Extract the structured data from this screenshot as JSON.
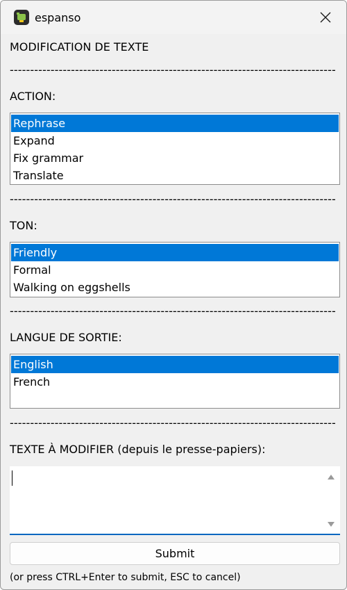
{
  "window": {
    "title": "espanso",
    "app_icon": "espanso-logo-icon",
    "close_icon": "close-icon"
  },
  "form": {
    "heading": "MODIFICATION DE TEXTE",
    "separator": "--------------------------------------------------------------------------------",
    "action": {
      "label": "ACTION:",
      "options": [
        "Rephrase",
        "Expand",
        "Fix grammar",
        "Translate"
      ],
      "selected": "Rephrase"
    },
    "tone": {
      "label": "TON:",
      "options": [
        "Friendly",
        "Formal",
        "Walking on eggshells"
      ],
      "selected": "Friendly"
    },
    "language": {
      "label": "LANGUE DE SORTIE:",
      "options": [
        "English",
        "French"
      ],
      "selected": "English"
    },
    "text": {
      "label": "TEXTE À MODIFIER (depuis le presse-papiers):",
      "value": ""
    },
    "submit_label": "Submit",
    "hint": "(or press CTRL+Enter to submit, ESC to cancel)"
  },
  "colors": {
    "selection": "#0078d7",
    "focus_underline": "#0067c0",
    "window_bg": "#f0f0f0"
  }
}
